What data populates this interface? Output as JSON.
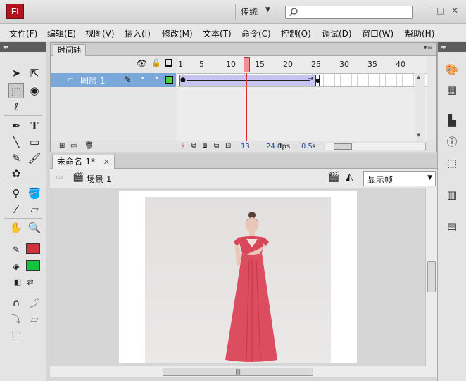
{
  "app": {
    "logo_text": "Fl",
    "workspace": "传统",
    "search_placeholder": ""
  },
  "menu": [
    "文件(F)",
    "编辑(E)",
    "视图(V)",
    "插入(I)",
    "修改(M)",
    "文本(T)",
    "命令(C)",
    "控制(O)",
    "调试(D)",
    "窗口(W)",
    "帮助(H)"
  ],
  "timeline": {
    "tab_label": "时间轴",
    "frame_numbers": [
      "1",
      "5",
      "10",
      "15",
      "20",
      "25",
      "30",
      "35",
      "40"
    ],
    "layer_name": "图层 1",
    "current_frame": "13",
    "fps": "24.0",
    "fps_unit": "fps",
    "elapsed": "0.5",
    "elapsed_unit": "s"
  },
  "document": {
    "tab_label": "未命名-1*",
    "scene_label": "场景 1",
    "zoom_value": "显示帧"
  },
  "colors": {
    "stroke_color": "#d0333b",
    "fill_color": "#14c43c",
    "layer_selected": "#7aa8d9",
    "playhead": "#e02b35"
  },
  "icons": {
    "left_toolbar": [
      "selection-tool-icon",
      "subselection-tool-icon",
      "free-transform-tool-icon",
      "3d-rotation-tool-icon",
      "lasso-tool-icon",
      "pen-tool-icon",
      "text-tool-icon",
      "line-tool-icon",
      "rectangle-tool-icon",
      "pencil-tool-icon",
      "brush-tool-icon",
      "deco-tool-icon",
      "bone-tool-icon",
      "paint-bucket-tool-icon",
      "eyedropper-tool-icon",
      "eraser-tool-icon",
      "hand-tool-icon",
      "zoom-tool-icon",
      "stroke-color-icon",
      "fill-color-icon",
      "snap-icon",
      "smooth-icon",
      "straighten-icon"
    ],
    "right_panel": [
      "color-panel-icon",
      "swatches-panel-icon",
      "align-panel-icon",
      "info-panel-icon",
      "transform-panel-icon",
      "library-panel-icon",
      "components-panel-icon"
    ]
  }
}
